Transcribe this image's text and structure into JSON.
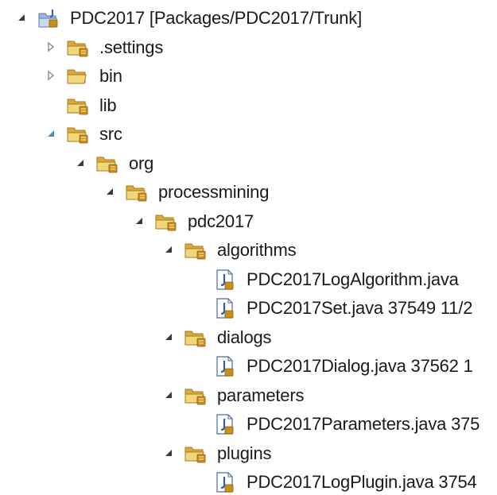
{
  "tree": [
    {
      "name": "project-root",
      "label": "PDC2017 [Packages/PDC2017/Trunk]",
      "depth": 0,
      "icon": "java-project-icon",
      "twisty": "expanded-dark"
    },
    {
      "name": "folder-settings",
      "label": ".settings",
      "depth": 1,
      "icon": "package-folder-icon",
      "twisty": "collapsed"
    },
    {
      "name": "folder-bin",
      "label": "bin",
      "depth": 1,
      "icon": "folder-icon",
      "twisty": "collapsed"
    },
    {
      "name": "folder-lib",
      "label": "lib",
      "depth": 1,
      "icon": "package-folder-icon",
      "twisty": "none"
    },
    {
      "name": "folder-src",
      "label": "src",
      "depth": 1,
      "icon": "package-folder-icon",
      "twisty": "expanded-blue"
    },
    {
      "name": "folder-org",
      "label": "org",
      "depth": 2,
      "icon": "package-folder-icon",
      "twisty": "expanded-dark"
    },
    {
      "name": "folder-processmining",
      "label": "processmining",
      "depth": 3,
      "icon": "package-folder-icon",
      "twisty": "expanded-dark"
    },
    {
      "name": "folder-pdc2017",
      "label": "pdc2017",
      "depth": 4,
      "icon": "package-folder-icon",
      "twisty": "expanded-dark"
    },
    {
      "name": "folder-algorithms",
      "label": "algorithms",
      "depth": 5,
      "icon": "package-folder-icon",
      "twisty": "expanded-dark"
    },
    {
      "name": "file-logalgorithm",
      "label": "PDC2017LogAlgorithm.java",
      "depth": 6,
      "icon": "java-file-icon",
      "twisty": "none"
    },
    {
      "name": "file-set",
      "label": "PDC2017Set.java 37549  11/2",
      "depth": 6,
      "icon": "java-file-icon",
      "twisty": "none"
    },
    {
      "name": "folder-dialogs",
      "label": "dialogs",
      "depth": 5,
      "icon": "package-folder-icon",
      "twisty": "expanded-dark"
    },
    {
      "name": "file-dialog",
      "label": "PDC2017Dialog.java 37562  1",
      "depth": 6,
      "icon": "java-file-icon",
      "twisty": "none"
    },
    {
      "name": "folder-parameters",
      "label": "parameters",
      "depth": 5,
      "icon": "package-folder-icon",
      "twisty": "expanded-dark"
    },
    {
      "name": "file-parameters",
      "label": "PDC2017Parameters.java 375",
      "depth": 6,
      "icon": "java-file-icon",
      "twisty": "none"
    },
    {
      "name": "folder-plugins",
      "label": "plugins",
      "depth": 5,
      "icon": "package-folder-icon",
      "twisty": "expanded-dark"
    },
    {
      "name": "file-logplugin",
      "label": "PDC2017LogPlugin.java 3754",
      "depth": 6,
      "icon": "java-file-icon",
      "twisty": "none"
    }
  ],
  "colors": {
    "folder_front": "#f2d77a",
    "folder_back": "#d9a93c",
    "folder_edge": "#a8791c",
    "package_badge": "#c98f1a",
    "twisty_dark": "#3a3a3a",
    "twisty_blue": "#3d8fd6",
    "twisty_collapsed": "#8a8a8a",
    "java_blue": "#2f5fa8"
  }
}
